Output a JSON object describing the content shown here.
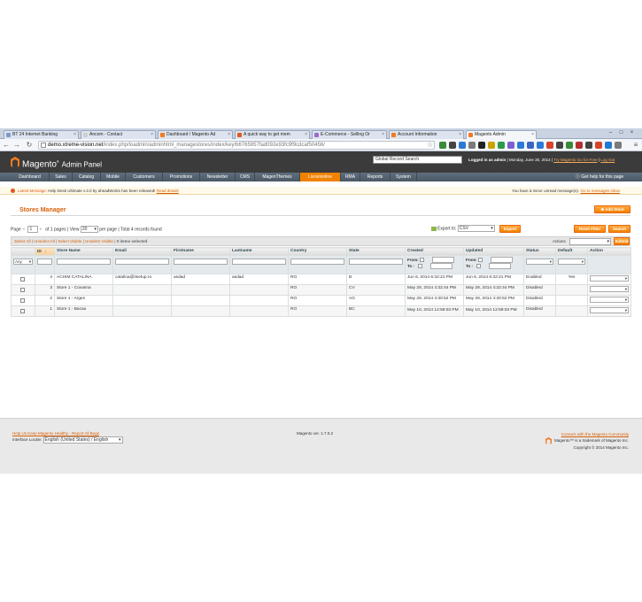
{
  "browser": {
    "tabs": [
      {
        "label": "BT 24 Internet Banking",
        "icon_color": "#7a9cc6"
      },
      {
        "label": "Ancom - Contact",
        "icon_color": "#cfcfcf"
      },
      {
        "label": "Dashboard / Magento Ad",
        "icon_color": "#f37a21"
      },
      {
        "label": "A quick way to get mem",
        "icon_color": "#e05a1a"
      },
      {
        "label": "E-Commerce - Selling Or",
        "icon_color": "#9c6ad0"
      },
      {
        "label": "Account Information",
        "icon_color": "#f37a21"
      },
      {
        "label": "Magento Admin",
        "icon_color": "#f37a21"
      }
    ],
    "url_host": "demo.xtreme-vision.net",
    "url_path": "/index.php/loadmin/adminhtml_managestores/index/key/b6765957fad092e93fc9f9cdcaf50456/",
    "extension_colors": [
      "#3a8a3a",
      "#444444",
      "#2b7bd6",
      "#7b7b7b",
      "#222222",
      "#c9a400",
      "#2b9a4a",
      "#7e5fd0",
      "#2b7bd6",
      "#3a66c2",
      "#2b7bd6",
      "#d6442b",
      "#444444",
      "#3a8a3a",
      "#b23030",
      "#444444",
      "#d6442b",
      "#1e7bd0",
      "#7b7b7b"
    ]
  },
  "header": {
    "logo_name": "Magento",
    "logo_sub": "Admin Panel",
    "global_search": "Global Record Search",
    "logged_in": "Logged in as admin",
    "date": "Monday, June 30, 2014",
    "try_link": "Try Magento Go for Free",
    "logout": "Log Out"
  },
  "nav": {
    "items": [
      "Dashboard",
      "Sales",
      "Catalog",
      "Mobile",
      "Customers",
      "Promotions",
      "Newsletter",
      "CMS",
      "MagenThemes",
      "Livrarionline",
      "RMA",
      "Reports",
      "System"
    ],
    "active_index": 9,
    "help": "Get help for this page"
  },
  "message": {
    "prefix": "Latest Message:",
    "text": "Help Desk Ultimate v.3.0 by aheadWorks has been released!",
    "read": "Read details",
    "right_prefix": "You have",
    "right_count": "1",
    "right_text": "minor unread message(s).",
    "go_link": "Go to messages inbox"
  },
  "page": {
    "title": "Stores Manager",
    "add_store": "Add Store",
    "reset_filter": "Reset Filter",
    "search": "Search",
    "export_label": "Export to:",
    "export_format": "CSV",
    "export_btn": "Export"
  },
  "pager": {
    "page_label": "Page",
    "page_value": "1",
    "of_pages": "of 1 pages",
    "view_label": "View",
    "per_page_value": "20",
    "per_page": "per page",
    "total": "Total 4 records found"
  },
  "massaction": {
    "select_all": "Select All",
    "unselect_all": "Unselect All",
    "select_visible": "Select Visible",
    "unselect_visible": "Unselect Visible",
    "selected": "0 items selected",
    "actions_label": "Actions",
    "submit": "Submit"
  },
  "grid": {
    "columns": [
      "",
      "ID",
      "Store Name",
      "Email",
      "Firstname",
      "Lastname",
      "Country",
      "State",
      "Created",
      "Updated",
      "Status",
      "Default",
      "Action"
    ],
    "filter_any": "Any",
    "from": "From:",
    "to": "To :",
    "rows": [
      {
        "id": "4",
        "name": "ACHIM CATALINA",
        "email": "catalina@itsetup.ro",
        "firstname": "asdad",
        "lastname": "asdad",
        "country": "RO",
        "state": "B",
        "created": "Jun 6, 2014 6:32:21 PM",
        "updated": "Jun 6, 2014 6:32:21 PM",
        "status": "Enabled",
        "default": "Yes"
      },
      {
        "id": "3",
        "name": "Store 1 - Covasna",
        "email": "",
        "firstname": "",
        "lastname": "",
        "country": "RO",
        "state": "CV",
        "created": "May 28, 2014 4:32:44 PM",
        "updated": "May 28, 2014 4:32:44 PM",
        "status": "Disabled",
        "default": ""
      },
      {
        "id": "2",
        "name": "Store 1 - Arges",
        "email": "",
        "firstname": "",
        "lastname": "",
        "country": "RO",
        "state": "AG",
        "created": "May 28, 2014 4:30:52 PM",
        "updated": "May 28, 2014 4:30:52 PM",
        "status": "Disabled",
        "default": ""
      },
      {
        "id": "1",
        "name": "Store 1 - Bacau",
        "email": "",
        "firstname": "",
        "lastname": "",
        "country": "RO",
        "state": "BC",
        "created": "May 10, 2014 12:59:03 PM",
        "updated": "May 10, 2014 12:59:03 PM",
        "status": "Disabled",
        "default": ""
      }
    ]
  },
  "footer": {
    "help_link": "Help Us Keep Magento Healthy - Report All Bugs",
    "locale_label": "Interface Locale:",
    "locale_value": "English (United States) / English",
    "version": "Magento ver. 1.7.0.2",
    "community": "Connect with the Magento Community",
    "trademark": "Magento™ is a trademark of Magento Inc.",
    "copyright": "Copyright © 2014 Magento Inc."
  }
}
